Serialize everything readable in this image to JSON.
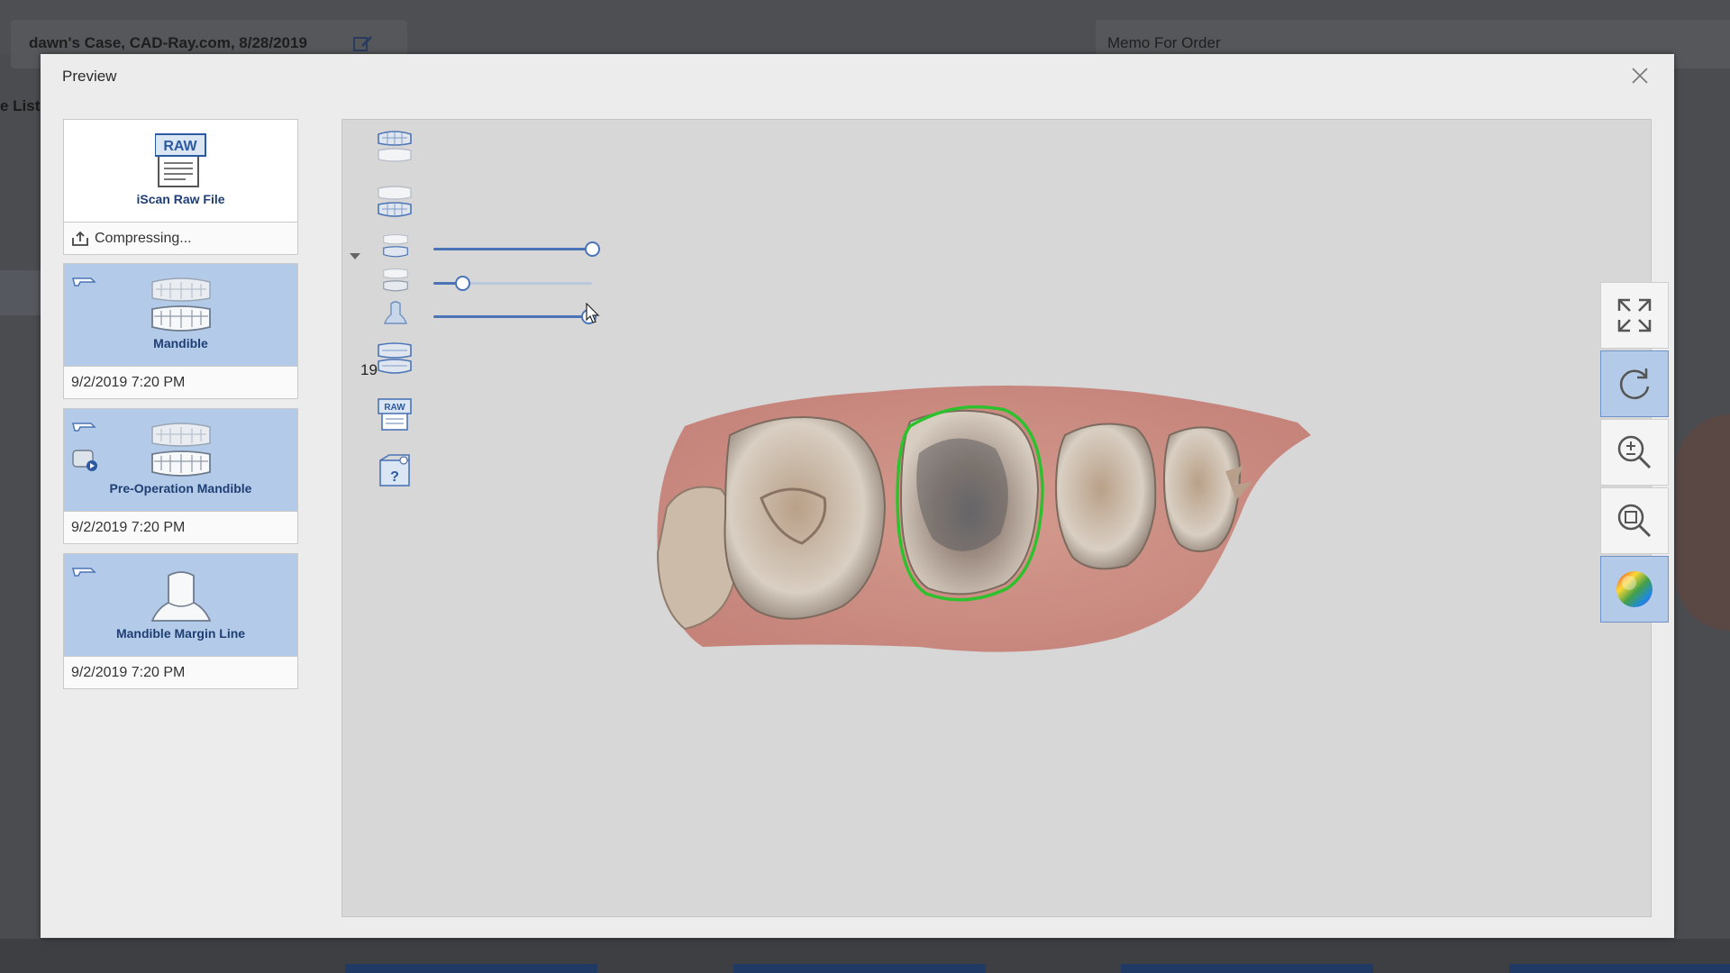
{
  "background": {
    "case_title": "dawn's Case, CAD-Ray.com, 8/28/2019",
    "memo_title": "Memo For Order",
    "list_label": "e List"
  },
  "dialog": {
    "title": "Preview",
    "close_icon": "close-icon"
  },
  "raw_file": {
    "label": "iScan Raw File",
    "status": "Compressing...",
    "icon": "raw-file-icon"
  },
  "scans": [
    {
      "label": "Mandible",
      "date": "9/2/2019 7:20 PM",
      "icon": "mandible-scan-icon"
    },
    {
      "label": "Pre-Operation Mandible",
      "date": "9/2/2019 7:20 PM",
      "icon": "pre-op-mandible-icon"
    },
    {
      "label": "Mandible Margin Line",
      "date": "9/2/2019 7:20 PM",
      "icon": "margin-line-icon"
    }
  ],
  "viewer": {
    "tooth_number": "19",
    "sliders": [
      {
        "name": "mandible-opacity",
        "value": 1.0
      },
      {
        "name": "pre-op-opacity",
        "value": 0.18
      },
      {
        "name": "margin-opacity",
        "value": 0.98
      }
    ]
  },
  "toolbar": [
    {
      "name": "fit-view-button",
      "icon": "fullscreen-icon",
      "active": false
    },
    {
      "name": "reset-rotation-button",
      "icon": "rotate-icon",
      "active": true
    },
    {
      "name": "zoom-button",
      "icon": "zoom-in-out-icon",
      "active": false
    },
    {
      "name": "zoom-window-button",
      "icon": "zoom-window-icon",
      "active": false
    },
    {
      "name": "color-map-button",
      "icon": "color-wheel-icon",
      "active": true
    }
  ],
  "colors": {
    "accent": "#4b74b6",
    "selected_card": "#b3cbe8",
    "margin_line": "#2ec12e"
  }
}
